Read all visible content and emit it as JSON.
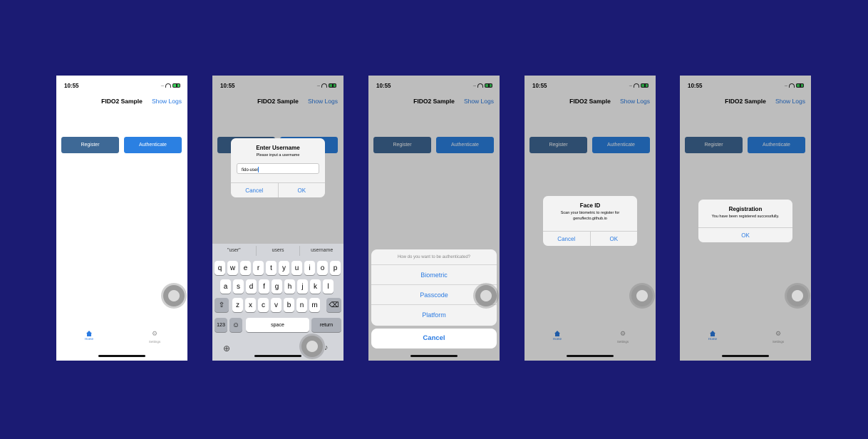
{
  "app": {
    "time": "10:55",
    "title": "FIDO2 Sample",
    "show_logs": "Show Logs",
    "register": "Register",
    "authenticate": "Authenticate",
    "tabs": [
      {
        "label": "Home",
        "icon": "home-icon"
      },
      {
        "label": "Settings",
        "icon": "gear-icon"
      }
    ]
  },
  "username_alert": {
    "title": "Enter Username",
    "message": "Please input a username",
    "value": "fido-user",
    "cancel": "Cancel",
    "ok": "OK"
  },
  "keyboard": {
    "suggestions": [
      "\"user\"",
      "users",
      "username"
    ],
    "row1": [
      "q",
      "w",
      "e",
      "r",
      "t",
      "y",
      "u",
      "i",
      "o",
      "p"
    ],
    "row2": [
      "a",
      "s",
      "d",
      "f",
      "g",
      "h",
      "j",
      "k",
      "l"
    ],
    "row3": [
      "z",
      "x",
      "c",
      "v",
      "b",
      "n",
      "m"
    ],
    "numbers": "123",
    "space": "space",
    "return": "return"
  },
  "auth_sheet": {
    "title": "How do you want to be authenticated?",
    "options": [
      "Biometric",
      "Passcode",
      "Platform"
    ],
    "cancel": "Cancel"
  },
  "faceid_alert": {
    "title": "Face ID",
    "message": "Scan your biometric to register for genuflecto.github.io",
    "cancel": "Cancel",
    "ok": "OK"
  },
  "registration_alert": {
    "title": "Registration",
    "message": "You have been registered successfully.",
    "ok": "OK"
  }
}
